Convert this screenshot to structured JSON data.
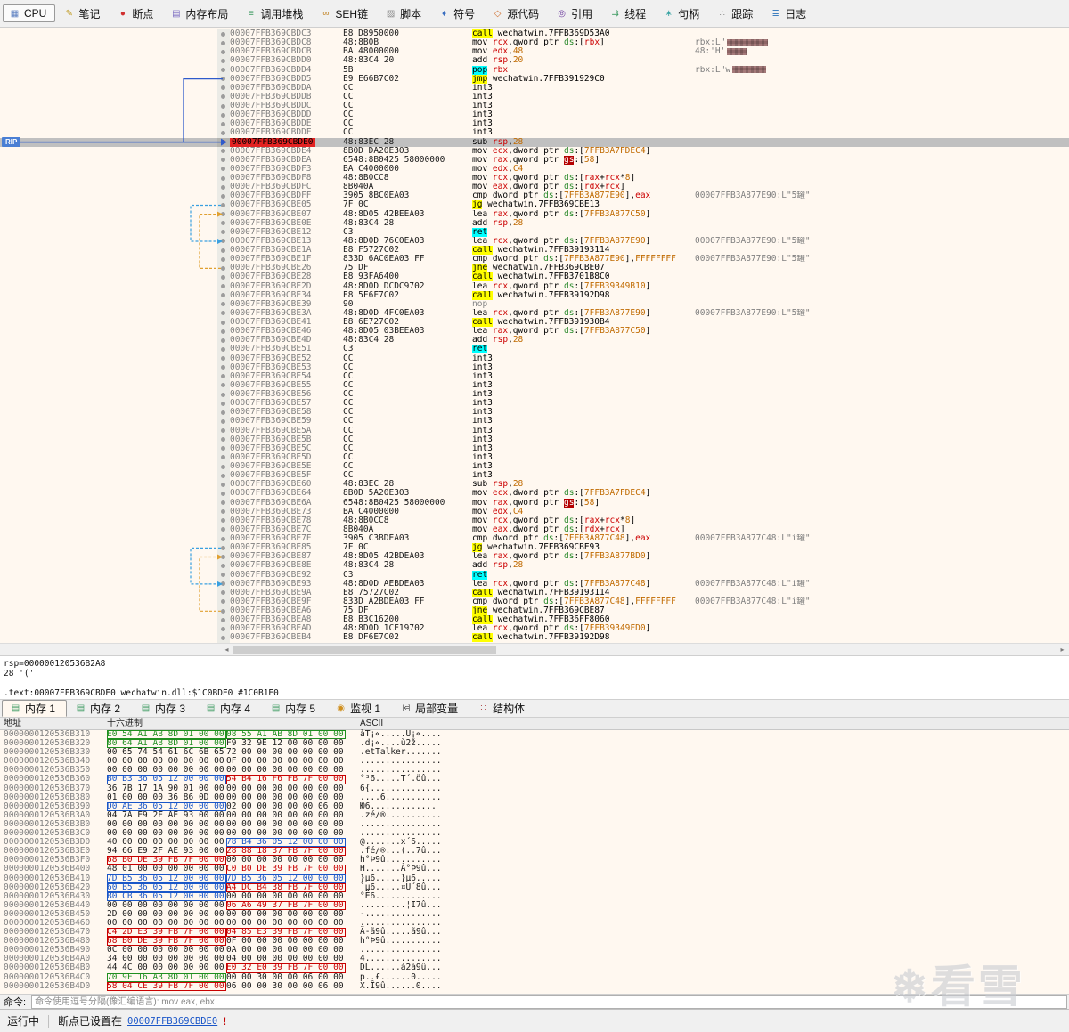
{
  "toolbar": {
    "tabs": [
      {
        "id": "cpu",
        "label": "CPU",
        "icon": "cpu-icon",
        "glyph": "▦",
        "color": "#5a7ec0",
        "active": true
      },
      {
        "id": "notes",
        "label": "笔记",
        "icon": "notes-icon",
        "glyph": "✎",
        "color": "#c09a20"
      },
      {
        "id": "breakpoints",
        "label": "断点",
        "icon": "breakpoint-icon",
        "glyph": "●",
        "color": "#d03030"
      },
      {
        "id": "memory-map",
        "label": "内存布局",
        "icon": "memory-map-icon",
        "glyph": "▤",
        "color": "#7a6ac0"
      },
      {
        "id": "call-stack",
        "label": "调用堆栈",
        "icon": "call-stack-icon",
        "glyph": "≡",
        "color": "#3f9b63"
      },
      {
        "id": "seh",
        "label": "SEH链",
        "icon": "seh-chain-icon",
        "glyph": "∞",
        "color": "#c08020"
      },
      {
        "id": "script",
        "label": "脚本",
        "icon": "script-icon",
        "glyph": "▨",
        "color": "#8a8a8a"
      },
      {
        "id": "symbols",
        "label": "符号",
        "icon": "symbols-icon",
        "glyph": "♦",
        "color": "#3a6ec0"
      },
      {
        "id": "source",
        "label": "源代码",
        "icon": "source-code-icon",
        "glyph": "◇",
        "color": "#d07030"
      },
      {
        "id": "references",
        "label": "引用",
        "icon": "references-icon",
        "glyph": "◎",
        "color": "#7040a0"
      },
      {
        "id": "threads",
        "label": "线程",
        "icon": "threads-icon",
        "glyph": "⇉",
        "color": "#3f9b63"
      },
      {
        "id": "handles",
        "label": "句柄",
        "icon": "handles-icon",
        "glyph": "∗",
        "color": "#30a0a0"
      },
      {
        "id": "trace",
        "label": "跟踪",
        "icon": "trace-icon",
        "glyph": "∴",
        "color": "#909090"
      },
      {
        "id": "log",
        "label": "日志",
        "icon": "log-icon",
        "glyph": "≣",
        "color": "#4080c0"
      }
    ]
  },
  "disasm": {
    "rip_label": "RIP",
    "rows": [
      {
        "a": "00007FFB369CBDC3",
        "b": "E8 D8950000",
        "i": "call wechatwin.7FFB369D53A0",
        "c": ""
      },
      {
        "a": "00007FFB369CBDC8",
        "b": "48:8B0B",
        "i": "mov rcx,qword ptr ds:[rbx]",
        "c": "rbx:L\"",
        "cen": true,
        "cw": 46
      },
      {
        "a": "00007FFB369CBDCB",
        "b": "BA 48000000",
        "i": "mov edx,48",
        "c": "48:'H'",
        "cen": true,
        "cw": 22
      },
      {
        "a": "00007FFB369CBDD0",
        "b": "48:83C4 20",
        "i": "add rsp,20",
        "c": ""
      },
      {
        "a": "00007FFB369CBDD4",
        "b": "5B",
        "i": "pop rbx",
        "c": "rbx:L\"w",
        "cen": true,
        "cw": 38
      },
      {
        "a": "00007FFB369CBDD5",
        "b": "E9 E66B7C02",
        "i": "jmp wechatwin.7FFB391929C0",
        "c": ""
      },
      {
        "a": "00007FFB369CBDDA",
        "b": "CC",
        "i": "int3",
        "c": ""
      },
      {
        "a": "00007FFB369CBDDB",
        "b": "CC",
        "i": "int3",
        "c": ""
      },
      {
        "a": "00007FFB369CBDDC",
        "b": "CC",
        "i": "int3",
        "c": ""
      },
      {
        "a": "00007FFB369CBDDD",
        "b": "CC",
        "i": "int3",
        "c": ""
      },
      {
        "a": "00007FFB369CBDDE",
        "b": "CC",
        "i": "int3",
        "c": ""
      },
      {
        "a": "00007FFB369CBDDF",
        "b": "CC",
        "i": "int3",
        "c": ""
      },
      {
        "a": "00007FFB369CBDE0",
        "b": "48:83EC 28",
        "i": "sub rsp,28",
        "c": "",
        "rip": true
      },
      {
        "a": "00007FFB369CBDE4",
        "b": "8B0D DA20E303",
        "i": "mov ecx,dword ptr ds:[7FFB3A7FDEC4]",
        "c": ""
      },
      {
        "a": "00007FFB369CBDEA",
        "b": "6548:8B0425 58000000",
        "i": "mov rax,qword ptr gs:[58]",
        "c": ""
      },
      {
        "a": "00007FFB369CBDF3",
        "b": "BA C4000000",
        "i": "mov edx,C4",
        "c": ""
      },
      {
        "a": "00007FFB369CBDF8",
        "b": "48:8B0CC8",
        "i": "mov rcx,qword ptr ds:[rax+rcx*8]",
        "c": ""
      },
      {
        "a": "00007FFB369CBDFC",
        "b": "8B040A",
        "i": "mov eax,dword ptr ds:[rdx+rcx]",
        "c": ""
      },
      {
        "a": "00007FFB369CBDFF",
        "b": "3905 8BC0EA03",
        "i": "cmp dword ptr ds:[7FFB3A877E90],eax",
        "c": "00007FFB3A877E90:L\"5罐\""
      },
      {
        "a": "00007FFB369CBE05",
        "b": "7F 0C",
        "i": "jg wechatwin.7FFB369CBE13",
        "c": ""
      },
      {
        "a": "00007FFB369CBE07",
        "b": "48:8D05 42BEEA03",
        "i": "lea rax,qword ptr ds:[7FFB3A877C50]",
        "c": ""
      },
      {
        "a": "00007FFB369CBE0E",
        "b": "48:83C4 28",
        "i": "add rsp,28",
        "c": ""
      },
      {
        "a": "00007FFB369CBE12",
        "b": "C3",
        "i": "ret",
        "c": ""
      },
      {
        "a": "00007FFB369CBE13",
        "b": "48:8D0D 76C0EA03",
        "i": "lea rcx,qword ptr ds:[7FFB3A877E90]",
        "c": "00007FFB3A877E90:L\"5罐\""
      },
      {
        "a": "00007FFB369CBE1A",
        "b": "E8 F5727C02",
        "i": "call wechatwin.7FFB39193114",
        "c": ""
      },
      {
        "a": "00007FFB369CBE1F",
        "b": "833D 6AC0EA03 FF",
        "i": "cmp dword ptr ds:[7FFB3A877E90],FFFFFFFF",
        "c": "00007FFB3A877E90:L\"5罐\""
      },
      {
        "a": "00007FFB369CBE26",
        "b": "75 DF",
        "i": "jne wechatwin.7FFB369CBE07",
        "c": ""
      },
      {
        "a": "00007FFB369CBE28",
        "b": "E8 93FA6400",
        "i": "call wechatwin.7FFB3701B8C0",
        "c": ""
      },
      {
        "a": "00007FFB369CBE2D",
        "b": "48:8D0D DCDC9702",
        "i": "lea rcx,qword ptr ds:[7FFB39349B10]",
        "c": ""
      },
      {
        "a": "00007FFB369CBE34",
        "b": "E8 5F6F7C02",
        "i": "call wechatwin.7FFB39192D98",
        "c": ""
      },
      {
        "a": "00007FFB369CBE39",
        "b": "90",
        "i": "nop",
        "c": ""
      },
      {
        "a": "00007FFB369CBE3A",
        "b": "48:8D0D 4FC0EA03",
        "i": "lea rcx,qword ptr ds:[7FFB3A877E90]",
        "c": "00007FFB3A877E90:L\"5罐\""
      },
      {
        "a": "00007FFB369CBE41",
        "b": "E8 6E727C02",
        "i": "call wechatwin.7FFB391930B4",
        "c": ""
      },
      {
        "a": "00007FFB369CBE46",
        "b": "48:8D05 03BEEA03",
        "i": "lea rax,qword ptr ds:[7FFB3A877C50]",
        "c": ""
      },
      {
        "a": "00007FFB369CBE4D",
        "b": "48:83C4 28",
        "i": "add rsp,28",
        "c": ""
      },
      {
        "a": "00007FFB369CBE51",
        "b": "C3",
        "i": "ret",
        "c": ""
      },
      {
        "a": "00007FFB369CBE52",
        "b": "CC",
        "i": "int3",
        "c": ""
      },
      {
        "a": "00007FFB369CBE53",
        "b": "CC",
        "i": "int3",
        "c": ""
      },
      {
        "a": "00007FFB369CBE54",
        "b": "CC",
        "i": "int3",
        "c": ""
      },
      {
        "a": "00007FFB369CBE55",
        "b": "CC",
        "i": "int3",
        "c": ""
      },
      {
        "a": "00007FFB369CBE56",
        "b": "CC",
        "i": "int3",
        "c": ""
      },
      {
        "a": "00007FFB369CBE57",
        "b": "CC",
        "i": "int3",
        "c": ""
      },
      {
        "a": "00007FFB369CBE58",
        "b": "CC",
        "i": "int3",
        "c": ""
      },
      {
        "a": "00007FFB369CBE59",
        "b": "CC",
        "i": "int3",
        "c": ""
      },
      {
        "a": "00007FFB369CBE5A",
        "b": "CC",
        "i": "int3",
        "c": ""
      },
      {
        "a": "00007FFB369CBE5B",
        "b": "CC",
        "i": "int3",
        "c": ""
      },
      {
        "a": "00007FFB369CBE5C",
        "b": "CC",
        "i": "int3",
        "c": ""
      },
      {
        "a": "00007FFB369CBE5D",
        "b": "CC",
        "i": "int3",
        "c": ""
      },
      {
        "a": "00007FFB369CBE5E",
        "b": "CC",
        "i": "int3",
        "c": ""
      },
      {
        "a": "00007FFB369CBE5F",
        "b": "CC",
        "i": "int3",
        "c": ""
      },
      {
        "a": "00007FFB369CBE60",
        "b": "48:83EC 28",
        "i": "sub rsp,28",
        "c": ""
      },
      {
        "a": "00007FFB369CBE64",
        "b": "8B0D 5A20E303",
        "i": "mov ecx,dword ptr ds:[7FFB3A7FDEC4]",
        "c": ""
      },
      {
        "a": "00007FFB369CBE6A",
        "b": "6548:8B0425 58000000",
        "i": "mov rax,qword ptr gs:[58]",
        "c": ""
      },
      {
        "a": "00007FFB369CBE73",
        "b": "BA C4000000",
        "i": "mov edx,C4",
        "c": ""
      },
      {
        "a": "00007FFB369CBE78",
        "b": "48:8B0CC8",
        "i": "mov rcx,qword ptr ds:[rax+rcx*8]",
        "c": ""
      },
      {
        "a": "00007FFB369CBE7C",
        "b": "8B040A",
        "i": "mov eax,dword ptr ds:[rdx+rcx]",
        "c": ""
      },
      {
        "a": "00007FFB369CBE7F",
        "b": "3905 C3BDEA03",
        "i": "cmp dword ptr ds:[7FFB3A877C48],eax",
        "c": "00007FFB3A877C48:L\"i罐\""
      },
      {
        "a": "00007FFB369CBE85",
        "b": "7F 0C",
        "i": "jg wechatwin.7FFB369CBE93",
        "c": ""
      },
      {
        "a": "00007FFB369CBE87",
        "b": "48:8D05 42BDEA03",
        "i": "lea rax,qword ptr ds:[7FFB3A877BD0]",
        "c": ""
      },
      {
        "a": "00007FFB369CBE8E",
        "b": "48:83C4 28",
        "i": "add rsp,28",
        "c": ""
      },
      {
        "a": "00007FFB369CBE92",
        "b": "C3",
        "i": "ret",
        "c": ""
      },
      {
        "a": "00007FFB369CBE93",
        "b": "48:8D0D AEBDEA03",
        "i": "lea rcx,qword ptr ds:[7FFB3A877C48]",
        "c": "00007FFB3A877C48:L\"i罐\""
      },
      {
        "a": "00007FFB369CBE9A",
        "b": "E8 75727C02",
        "i": "call wechatwin.7FFB39193114",
        "c": ""
      },
      {
        "a": "00007FFB369CBE9F",
        "b": "833D A2BDEA03 FF",
        "i": "cmp dword ptr ds:[7FFB3A877C48],FFFFFFFF",
        "c": "00007FFB3A877C48:L\"i罐\""
      },
      {
        "a": "00007FFB369CBEA6",
        "b": "75 DF",
        "i": "jne wechatwin.7FFB369CBE87",
        "c": ""
      },
      {
        "a": "00007FFB369CBEA8",
        "b": "E8 B3C16200",
        "i": "call wechatwin.7FFB36FF8060",
        "c": ""
      },
      {
        "a": "00007FFB369CBEAD",
        "b": "48:8D0D 1CE19702",
        "i": "lea rcx,qword ptr ds:[7FFB39349FD0]",
        "c": ""
      },
      {
        "a": "00007FFB369CBEB4",
        "b": "E8 DF6E7C02",
        "i": "call wechatwin.7FFB39192D98",
        "c": ""
      }
    ]
  },
  "info_panel": {
    "lines": [
      "rsp=000000120536B2A8",
      "28 '('",
      "",
      ".text:00007FFB369CBDE0 wechatwin.dll:$1C0BDE0 #1C0B1E0"
    ]
  },
  "dock_tabs": [
    {
      "id": "memory-1",
      "label": "内存 1",
      "icon": "memory-icon",
      "glyph": "▤",
      "color": "#3f9b63",
      "active": true
    },
    {
      "id": "memory-2",
      "label": "内存 2",
      "icon": "memory-icon",
      "glyph": "▤",
      "color": "#3f9b63"
    },
    {
      "id": "memory-3",
      "label": "内存 3",
      "icon": "memory-icon",
      "glyph": "▤",
      "color": "#3f9b63"
    },
    {
      "id": "memory-4",
      "label": "内存 4",
      "icon": "memory-icon",
      "glyph": "▤",
      "color": "#3f9b63"
    },
    {
      "id": "memory-5",
      "label": "内存 5",
      "icon": "memory-icon",
      "glyph": "▤",
      "color": "#3f9b63"
    },
    {
      "id": "watch-1",
      "label": "监视 1",
      "icon": "watch-icon",
      "glyph": "◉",
      "color": "#d09020"
    },
    {
      "id": "locals",
      "label": "局部变量",
      "icon": "locals-icon",
      "glyph": "[x=]",
      "color": "#404040",
      "small": true
    },
    {
      "id": "struct",
      "label": "结构体",
      "icon": "struct-icon",
      "glyph": "∷",
      "color": "#b05050"
    }
  ],
  "dump": {
    "columns": [
      "地址",
      "十六进制",
      "ASCII"
    ],
    "rows": [
      {
        "addr": "0000000120536B310",
        "g1": "E0 54 A1 AB 8D 01 00 00",
        "g2": "08 55 A1 AB 8D 01 00 00",
        "ascii": "àT¡«.....U¡«....",
        "c1": "heap",
        "c2": "heap"
      },
      {
        "addr": "0000000120536B320",
        "g1": "80 64 A1 AB 8D 01 00 00",
        "g2": "F9 32 9E 12 00 00 00 00",
        "ascii": ".d¡«....ù2ž.....",
        "c1": "heap",
        "c2": ""
      },
      {
        "addr": "0000000120536B330",
        "g1": "00 65 74 54 61 6C 6B 65",
        "g2": "72 00 00 00 00 00 00 00",
        "ascii": ".etTalker.......",
        "c1": "",
        "c2": ""
      },
      {
        "addr": "0000000120536B340",
        "g1": "00 00 00 00 00 00 00 00",
        "g2": "0F 00 00 00 00 00 00 00",
        "ascii": "................",
        "c1": "",
        "c2": ""
      },
      {
        "addr": "0000000120536B350",
        "g1": "00 00 00 00 00 00 00 00",
        "g2": "00 00 00 00 00 00 00 00",
        "ascii": "................",
        "c1": "",
        "c2": ""
      },
      {
        "addr": "0000000120536B360",
        "g1": "B0 B3 36 05 12 00 00 00",
        "g2": "54 B4 16 F6 FB 7F 00 00",
        "ascii": "°³6.....T´.öû...",
        "c1": "stack",
        "c2": "code"
      },
      {
        "addr": "0000000120536B370",
        "g1": "36 7B 17 1A 90 01 00 00",
        "g2": "00 00 00 00 00 00 00 00",
        "ascii": "6{..............",
        "c1": "",
        "c2": ""
      },
      {
        "addr": "0000000120536B380",
        "g1": "01 00 00 00 36 86 0D 00",
        "g2": "00 00 00 00 00 00 00 00",
        "ascii": "....6...........",
        "c1": "",
        "c2": ""
      },
      {
        "addr": "0000000120536B390",
        "g1": "D0 AE 36 05 12 00 00 00",
        "g2": "02 00 00 00 00 00 06 00",
        "ascii": "Ю6.............",
        "c1": "stack",
        "c2": ""
      },
      {
        "addr": "0000000120536B3A0",
        "g1": "04 7A E9 2F AE 93 00 00",
        "g2": "00 00 00 00 00 00 00 00",
        "ascii": ".zé/®...........",
        "c1": "",
        "c2": ""
      },
      {
        "addr": "0000000120536B3B0",
        "g1": "00 00 00 00 00 00 00 00",
        "g2": "00 00 00 00 00 00 00 00",
        "ascii": "................",
        "c1": "",
        "c2": ""
      },
      {
        "addr": "0000000120536B3C0",
        "g1": "00 00 00 00 00 00 00 00",
        "g2": "00 00 00 00 00 00 00 00",
        "ascii": "................",
        "c1": "",
        "c2": ""
      },
      {
        "addr": "0000000120536B3D0",
        "g1": "40 00 00 00 00 00 00 00",
        "g2": "78 B4 36 05 12 00 00 00",
        "ascii": "@.......x´6.....",
        "c1": "",
        "c2": "stack"
      },
      {
        "addr": "0000000120536B3E0",
        "g1": "94 66 E9 2F AE 93 00 00",
        "g2": "28 88 18 37 FB 7F 00 00",
        "ascii": ".fé/®...(..7û...",
        "c1": "",
        "c2": "code"
      },
      {
        "addr": "0000000120536B3F0",
        "g1": "68 B0 DE 39 FB 7F 00 00",
        "g2": "00 00 00 00 00 00 00 00",
        "ascii": "h°Þ9û...........",
        "c1": "code",
        "c2": ""
      },
      {
        "addr": "0000000120536B400",
        "g1": "48 01 00 00 00 00 00 00",
        "g2": "C0 B0 DE 39 FB 7F 00 00",
        "ascii": "H.......À°Þ9û...",
        "c1": "",
        "c2": "code"
      },
      {
        "addr": "0000000120536B410",
        "g1": "7D B5 36 05 12 00 00 00",
        "g2": "7D B5 36 05 12 00 00 00",
        "ascii": "}µ6.....}µ6.....",
        "c1": "stack",
        "c2": "stack"
      },
      {
        "addr": "0000000120536B420",
        "g1": "60 B5 36 05 12 00 00 00",
        "g2": "A4 DC B4 38 FB 7F 00 00",
        "ascii": "`µ6.....¤Ü´8û...",
        "c1": "stack",
        "c2": "code"
      },
      {
        "addr": "0000000120536B430",
        "g1": "B0 CB 36 05 12 00 00 00",
        "g2": "00 00 00 00 00 00 00 00",
        "ascii": "°Ë6.............",
        "c1": "stack",
        "c2": ""
      },
      {
        "addr": "0000000120536B440",
        "g1": "00 00 00 00 00 00 00 00",
        "g2": "06 A6 49 37 FB 7F 00 00",
        "ascii": ".........¦I7û...",
        "c1": "",
        "c2": "code"
      },
      {
        "addr": "0000000120536B450",
        "g1": "2D 00 00 00 00 00 00 00",
        "g2": "00 00 00 00 00 00 00 00",
        "ascii": "-...............",
        "c1": "",
        "c2": ""
      },
      {
        "addr": "0000000120536B460",
        "g1": "00 00 00 00 00 00 00 00",
        "g2": "00 00 00 00 00 00 00 00",
        "ascii": "................",
        "c1": "",
        "c2": ""
      },
      {
        "addr": "0000000120536B470",
        "g1": "C4 2D E3 39 FB 7F 00 00",
        "g2": "04 85 E3 39 FB 7F 00 00",
        "ascii": "Ä-ã9û.....ã9û...",
        "c1": "code",
        "c2": "code"
      },
      {
        "addr": "0000000120536B480",
        "g1": "68 B0 DE 39 FB 7F 00 00",
        "g2": "0F 00 00 00 00 00 00 00",
        "ascii": "h°Þ9û...........",
        "c1": "code",
        "c2": ""
      },
      {
        "addr": "0000000120536B490",
        "g1": "0C 00 00 00 00 00 00 00",
        "g2": "0A 00 00 00 00 00 00 00",
        "ascii": "................",
        "c1": "",
        "c2": ""
      },
      {
        "addr": "0000000120536B4A0",
        "g1": "34 00 00 00 00 00 00 00",
        "g2": "04 00 00 00 00 00 00 00",
        "ascii": "4...............",
        "c1": "",
        "c2": ""
      },
      {
        "addr": "0000000120536B4B0",
        "g1": "44 4C 00 00 00 00 00 00",
        "g2": "E0 32 E0 39 FB 7F 00 00",
        "ascii": "DL......à2à9û...",
        "c1": "",
        "c2": "code"
      },
      {
        "addr": "0000000120536B4C0",
        "g1": "70 9F 16 A3 8D 01 00 00",
        "g2": "00 00 30 00 00 06 00 00",
        "ascii": "p..£......0.....",
        "c1": "heap",
        "c2": ""
      },
      {
        "addr": "0000000120536B4D0",
        "g1": "58 04 CE 39 FB 7F 00 00",
        "g2": "06 00 00 30 00 00 06 00",
        "ascii": "X.Î9û......0....",
        "c1": "code",
        "c2": ""
      }
    ]
  },
  "command_bar": {
    "label": "命令:",
    "value": "",
    "placeholder": "命令使用逗号分隔(像汇编语言): mov eax, ebx"
  },
  "status_bar": {
    "state": "运行中",
    "message": "断点已设置在",
    "address": "00007FFB369CBDE0",
    "bang": "!"
  },
  "watermark": {
    "icon": "snowflake-icon",
    "text": "看雪"
  }
}
